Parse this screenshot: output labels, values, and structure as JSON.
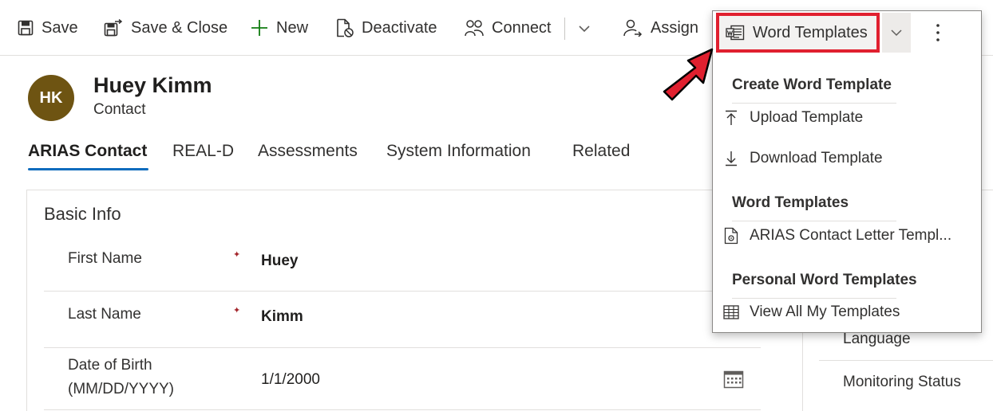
{
  "commandbar": {
    "save": "Save",
    "save_close": "Save & Close",
    "new": "New",
    "deactivate": "Deactivate",
    "connect": "Connect",
    "assign": "Assign"
  },
  "record": {
    "initials": "HK",
    "name": "Huey Kimm",
    "type": "Contact"
  },
  "tabs": [
    {
      "label": "ARIAS Contact",
      "active": true
    },
    {
      "label": "REAL-D"
    },
    {
      "label": "Assessments"
    },
    {
      "label": "System Information"
    },
    {
      "label": "Related"
    }
  ],
  "form": {
    "section_title": "Basic Info",
    "fields": [
      {
        "label": "First Name",
        "value": "Huey",
        "required": true
      },
      {
        "label": "Last Name",
        "value": "Kimm",
        "required": true
      },
      {
        "label_line1": "Date of Birth",
        "label_line2": "(MM/DD/YYYY)",
        "value": "1/1/2000"
      }
    ]
  },
  "side_panel": {
    "labels": [
      "Language",
      "Monitoring Status"
    ]
  },
  "word_templates_menu": {
    "button_label": "Word Templates",
    "groups": [
      {
        "title": "Create Word Template",
        "items": [
          "Upload Template",
          "Download Template"
        ]
      },
      {
        "title": "Word Templates",
        "items": [
          "ARIAS Contact Letter Templ..."
        ]
      },
      {
        "title": "Personal Word Templates",
        "items": [
          "View All My Templates"
        ]
      }
    ]
  },
  "colors": {
    "avatar_bg": "#6e5412",
    "accent": "#0f6cbd",
    "callout_red": "#e0202f"
  }
}
